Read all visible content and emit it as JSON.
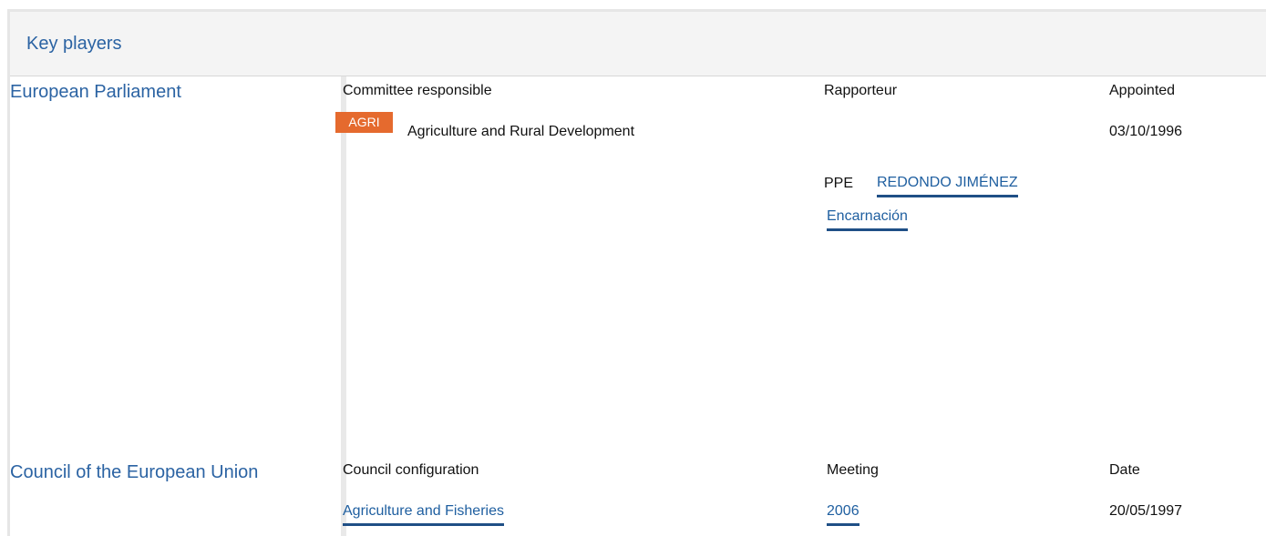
{
  "header": {
    "title": "Key players"
  },
  "parliament": {
    "name": "European Parliament",
    "columns": {
      "committee": "Committee responsible",
      "rapporteur": "Rapporteur",
      "appointed": "Appointed"
    },
    "committee_code": "AGRI",
    "committee_name": "Agriculture and Rural Development",
    "appointed_date": "03/10/1996",
    "rapporteur_group": "PPE",
    "rapporteur_name_line1": "REDONDO JIMÉNEZ",
    "rapporteur_name_line2": "Encarnación"
  },
  "council": {
    "name": "Council of the European Union",
    "columns": {
      "configuration": "Council configuration",
      "meeting": "Meeting",
      "date": "Date"
    },
    "configuration": "Agriculture and Fisheries",
    "meeting": "2006",
    "date": "20/05/1997"
  },
  "colors": {
    "accent_link": "#1f5fa0",
    "badge": "#e56a2e",
    "institution": "#2b63a3"
  }
}
